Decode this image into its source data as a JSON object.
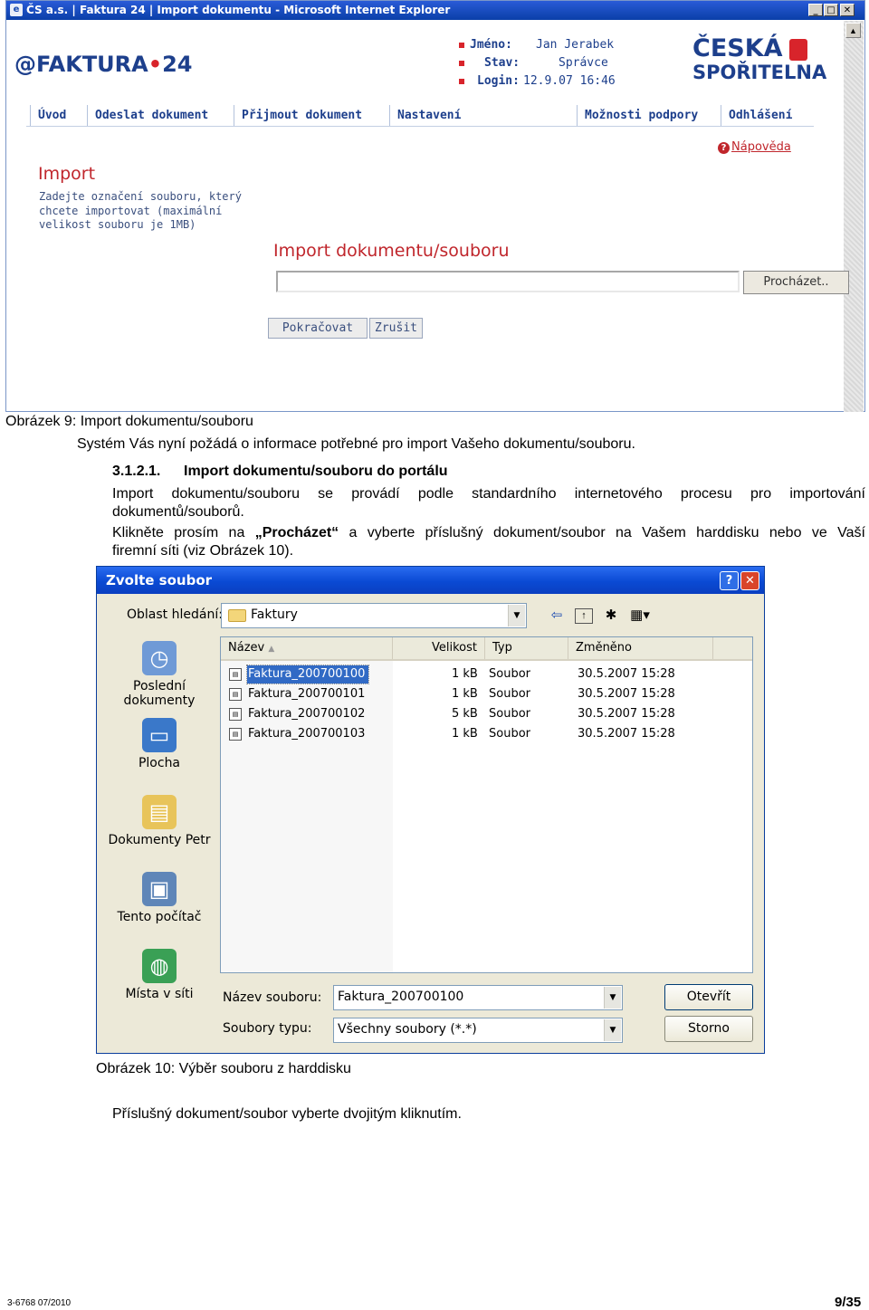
{
  "ie_window": {
    "title": "ČS a.s. | Faktura 24 | Import dokumentu - Microsoft Internet Explorer",
    "logo": {
      "prefix": "@FAKTURA",
      "dot": "•",
      "suffix": "24"
    },
    "user_info": {
      "name_label": "Jméno:",
      "name_value": "Jan Jerabek",
      "status_label": "Stav:",
      "status_value": "Správce",
      "login_label": "Login:",
      "login_value": "12.9.07 16:46"
    },
    "bank_logo": {
      "line1": "ČESKÁ",
      "line2": "SPOŘITELNA"
    },
    "nav": [
      "Úvod",
      "Odeslat dokument",
      "Přijmout dokument",
      "Nastavení",
      "Možnosti podpory",
      "Odhlášení"
    ],
    "help_link": "Nápověda",
    "import_heading": "Import",
    "import_description": "Zadejte označení souboru, který chcete importovat (maximální velikost souboru je 1MB)",
    "import_subheading": "Import dokumentu/souboru",
    "browse_button": "Procházet..",
    "continue_button": "Pokračovat",
    "cancel_button": "Zrušit"
  },
  "caption_9": "Obrázek 9: Import dokumentu/souboru",
  "para_1": "Systém Vás nyní požádá o informace potřebné pro import Vašeho dokumentu/souboru.",
  "section": {
    "number": "3.1.2.1.",
    "title": "Import dokumentu/souboru do portálu"
  },
  "para_2": {
    "line1_words": [
      "Import",
      "dokumentu/souboru",
      "se",
      "provádí",
      "podle",
      "standardního",
      "internetového",
      "procesu",
      "pro",
      "importování"
    ],
    "line2": "dokumentů/souborů."
  },
  "para_3": {
    "line1_words_a": [
      "Klikněte",
      "prosím",
      "na"
    ],
    "bold": "„Procházet“",
    "line1_words_b": [
      "a",
      "vyberte",
      "příslušný",
      "dokument/soubor",
      "na",
      "Vašem",
      "harddisku",
      "nebo",
      "ve",
      "Vaší"
    ],
    "line2": "firemní síti (viz Obrázek 10)."
  },
  "dialog": {
    "title": "Zvolte soubor",
    "help_btn": "?",
    "close_btn": "✕",
    "look_in_label": "Oblast hledání:",
    "look_in_value": "Faktury",
    "places": [
      "Poslední dokumenty",
      "Plocha",
      "Dokumenty Petr",
      "Tento počítač",
      "Místa v síti"
    ],
    "columns": [
      "Název",
      "Velikost",
      "Typ",
      "Změněno"
    ],
    "files": [
      {
        "name": "Faktura_200700100",
        "size": "1 kB",
        "type": "Soubor",
        "modified": "30.5.2007 15:28"
      },
      {
        "name": "Faktura_200700101",
        "size": "1 kB",
        "type": "Soubor",
        "modified": "30.5.2007 15:28"
      },
      {
        "name": "Faktura_200700102",
        "size": "5 kB",
        "type": "Soubor",
        "modified": "30.5.2007 15:28"
      },
      {
        "name": "Faktura_200700103",
        "size": "1 kB",
        "type": "Soubor",
        "modified": "30.5.2007 15:28"
      }
    ],
    "filename_label": "Název souboru:",
    "filename_value": "Faktura_200700100",
    "filetype_label": "Soubory typu:",
    "filetype_value": "Všechny soubory (*.*)",
    "open_button": "Otevřít",
    "cancel_button": "Storno"
  },
  "caption_10": "Obrázek 10: Výběr souboru z harddisku",
  "para_4": "Příslušný dokument/soubor vyberte dvojitým kliknutím.",
  "footer": {
    "doc_id": "3-6768 07/2010",
    "page": "9/35"
  }
}
